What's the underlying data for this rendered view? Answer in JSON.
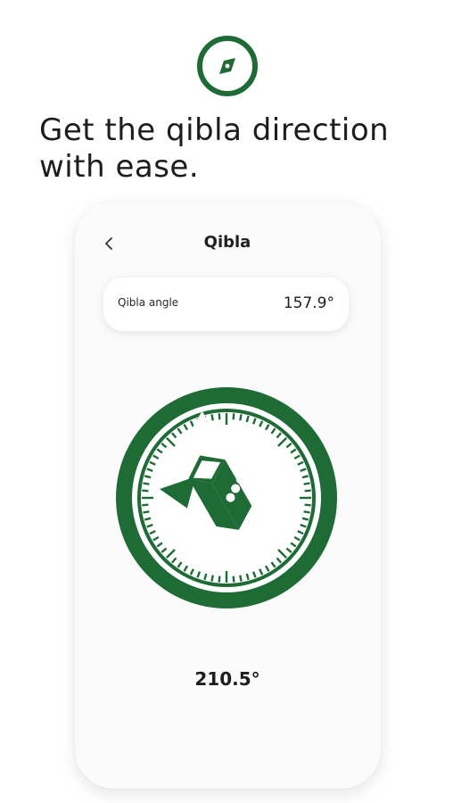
{
  "brand": {
    "icon": "compass-icon",
    "color": "#1e6b35"
  },
  "headline": {
    "line1": "Get the qibla direction",
    "line2": "with ease."
  },
  "screen": {
    "back_icon": "chevron-left-icon",
    "title": "Qibla"
  },
  "angle_card": {
    "label": "Qibla angle",
    "value": "157.9°"
  },
  "compass": {
    "icon": "kaaba-compass-dial",
    "color": "#1e6b35",
    "heading_value": "210.5°"
  }
}
